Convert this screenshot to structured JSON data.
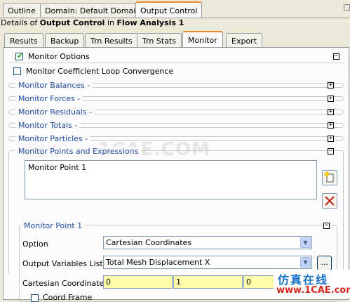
{
  "top_tabs": [
    {
      "label": "Outline"
    },
    {
      "label": "Domain: Default Domain"
    },
    {
      "label": "Output Control"
    }
  ],
  "details": {
    "prefix": "Details of ",
    "object": "Output Control",
    "middle": " in ",
    "analysis": "Flow Analysis 1"
  },
  "sub_tabs": [
    {
      "label": "Results"
    },
    {
      "label": "Backup"
    },
    {
      "label": "Trn Results"
    },
    {
      "label": "Trn Stats"
    },
    {
      "label": "Monitor"
    },
    {
      "label": "Export"
    }
  ],
  "monitor_options": {
    "label": "Monitor Options",
    "checked": true
  },
  "monitor_coeff": {
    "label": "Monitor Coefficient Loop Convergence",
    "checked": false
  },
  "sections": [
    {
      "label": "Monitor Balances -"
    },
    {
      "label": "Monitor Forces -"
    },
    {
      "label": "Monitor Residuals -"
    },
    {
      "label": "Monitor Totals -"
    },
    {
      "label": "Monitor Particles -"
    }
  ],
  "points_section": {
    "label": "Monitor Points and Expressions",
    "items": [
      "Monitor Point 1"
    ]
  },
  "monitor_point": {
    "title": "Monitor Point 1",
    "option_label": "Option",
    "option_value": "Cartesian Coordinates",
    "ovl_label": "Output Variables List",
    "ovl_value": "Total Mesh Displacement X",
    "ovl_button": "...",
    "coords_label": "Cartesian Coordinates",
    "coords": [
      "0",
      "1",
      "0"
    ],
    "coord_frame_label": "Coord Frame"
  },
  "watermark": "1CAE.COM",
  "brand": {
    "cn": "仿真在线",
    "url": "www.1CAE.com"
  },
  "colors": {
    "section_blue": "#1e4ba0",
    "tab_accent": "#e68b2c",
    "field_yellow": "#ffffa8"
  }
}
